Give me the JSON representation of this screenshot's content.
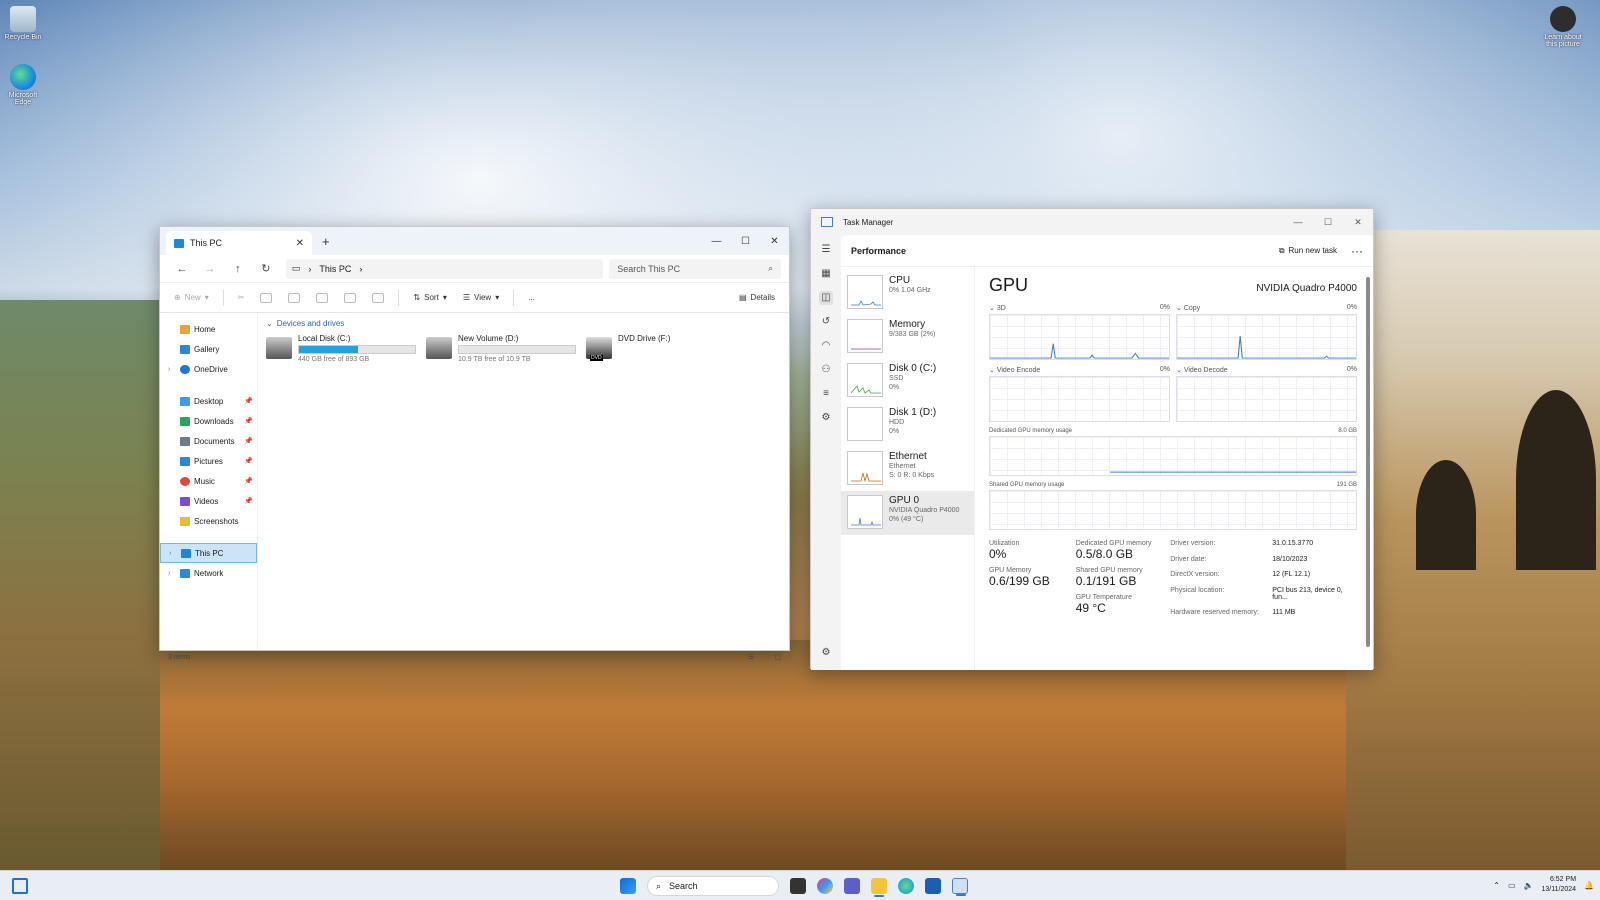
{
  "desktop": {
    "icons": [
      {
        "label": "Recycle Bin"
      },
      {
        "label": "Microsoft Edge"
      },
      {
        "label": "Learn about this picture"
      }
    ]
  },
  "explorer": {
    "tab_title": "This PC",
    "address": "This PC",
    "search_placeholder": "Search This PC",
    "toolbar": {
      "new": "New",
      "sort": "Sort",
      "view": "View",
      "more": "...",
      "details": "Details"
    },
    "sidebar": [
      {
        "label": "Home",
        "color": "#e8a33d"
      },
      {
        "label": "Gallery",
        "color": "#2b88d8"
      },
      {
        "label": "OneDrive",
        "color": "#1e78d6"
      },
      {
        "label": "Desktop",
        "color": "#3d9be9"
      },
      {
        "label": "Downloads",
        "color": "#2aa55a"
      },
      {
        "label": "Documents",
        "color": "#6d7b8a"
      },
      {
        "label": "Pictures",
        "color": "#2b88d8"
      },
      {
        "label": "Music",
        "color": "#e0483e"
      },
      {
        "label": "Videos",
        "color": "#7b4fc8"
      },
      {
        "label": "Screenshots",
        "color": "#e8b93d"
      },
      {
        "label": "This PC",
        "color": "#1e88d6"
      },
      {
        "label": "Network",
        "color": "#2b88d8"
      }
    ],
    "group_label": "Devices and drives",
    "drives": [
      {
        "name": "Local Disk (C:)",
        "size": "440 GB free of 893 GB",
        "used": 0.507
      },
      {
        "name": "New Volume (D:)",
        "size": "10.9 TB free of 10.9 TB",
        "used": 0.0
      },
      {
        "name": "DVD Drive (F:)",
        "badge": "DVD"
      }
    ],
    "status": "3 items"
  },
  "taskmgr": {
    "title": "Task Manager",
    "page_title": "Performance",
    "run_new_task": "Run new task",
    "list": [
      {
        "name": "CPU",
        "sub1": "0% 1.04 GHz",
        "sub2": "",
        "sub3": "",
        "color": "#3a7bd5"
      },
      {
        "name": "Memory",
        "sub1": "9/383 GB (2%)",
        "sub2": "",
        "sub3": "",
        "color": "#8b3db5"
      },
      {
        "name": "Disk 0 (C:)",
        "sub1": "SSD",
        "sub2": "0%",
        "sub3": "",
        "color": "#4aa843"
      },
      {
        "name": "Disk 1 (D:)",
        "sub1": "HDD",
        "sub2": "0%",
        "sub3": "",
        "color": "#4aa843"
      },
      {
        "name": "Ethernet",
        "sub1": "Ethernet",
        "sub2": "S: 0 R: 0 Kbps",
        "sub3": "",
        "color": "#c96a1d"
      },
      {
        "name": "GPU 0",
        "sub1": "NVIDIA Quadro P4000",
        "sub2": "0% (49 °C)",
        "sub3": "",
        "color": "#3a7bd5"
      }
    ],
    "detail": {
      "heading": "GPU",
      "model": "NVIDIA Quadro P4000",
      "graphs": [
        {
          "label": "3D",
          "pct": "0%"
        },
        {
          "label": "Copy",
          "pct": "0%"
        },
        {
          "label": "Video Encode",
          "pct": "0%"
        },
        {
          "label": "Video Decode",
          "pct": "0%"
        }
      ],
      "dedicated_label": "Dedicated GPU memory usage",
      "dedicated_max": "8.0 GB",
      "shared_label": "Shared GPU memory usage",
      "shared_max": "191 GB",
      "stats": {
        "utilization_label": "Utilization",
        "utilization": "0%",
        "gpu_memory_label": "GPU Memory",
        "gpu_memory": "0.6/199 GB",
        "dedicated_label": "Dedicated GPU memory",
        "dedicated": "0.5/8.0 GB",
        "shared_label": "Shared GPU memory",
        "shared": "0.1/191 GB",
        "temp_label": "GPU Temperature",
        "temp": "49 °C"
      },
      "info": [
        {
          "k": "Driver version:",
          "v": "31.0.15.3770"
        },
        {
          "k": "Driver date:",
          "v": "18/10/2023"
        },
        {
          "k": "DirectX version:",
          "v": "12 (FL 12.1)"
        },
        {
          "k": "Physical location:",
          "v": "PCI bus 213, device 0, fun..."
        },
        {
          "k": "Hardware reserved memory:",
          "v": "111 MB"
        }
      ]
    }
  },
  "taskbar": {
    "search": "Search",
    "time": "6:52 PM",
    "date": "13/11/2024"
  }
}
